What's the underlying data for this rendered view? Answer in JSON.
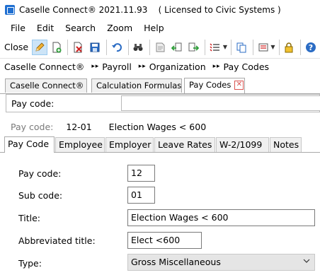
{
  "window": {
    "title": "Caselle Connect® 2021.11.93    ( Licensed to Civic Systems )"
  },
  "menu": [
    "File",
    "Edit",
    "Search",
    "Zoom",
    "Help"
  ],
  "toolbar": {
    "close_label": "Close"
  },
  "breadcrumb": [
    "Caselle Connect®",
    "Payroll",
    "Organization",
    "Pay Codes"
  ],
  "tabs": [
    {
      "label": "Caselle Connect®"
    },
    {
      "label": "Calculation Formulas"
    },
    {
      "label": "Pay Codes"
    }
  ],
  "lookup": {
    "label": "Pay code:",
    "value": ""
  },
  "record": {
    "label": "Pay code:",
    "code": "12-01",
    "description": "Election Wages < 600"
  },
  "subtabs": [
    "Pay Code",
    "Employee",
    "Employer",
    "Leave Rates",
    "W-2/1099",
    "Notes"
  ],
  "form": {
    "pay_code": {
      "label": "Pay code:",
      "value": "12"
    },
    "sub_code": {
      "label": "Sub code:",
      "value": "01"
    },
    "title": {
      "label": "Title:",
      "value": "Election Wages < 600"
    },
    "abbrev": {
      "label": "Abbreviated title:",
      "value": "Elect <600"
    },
    "type": {
      "label": "Type:",
      "value": "Gross Miscellaneous"
    }
  }
}
